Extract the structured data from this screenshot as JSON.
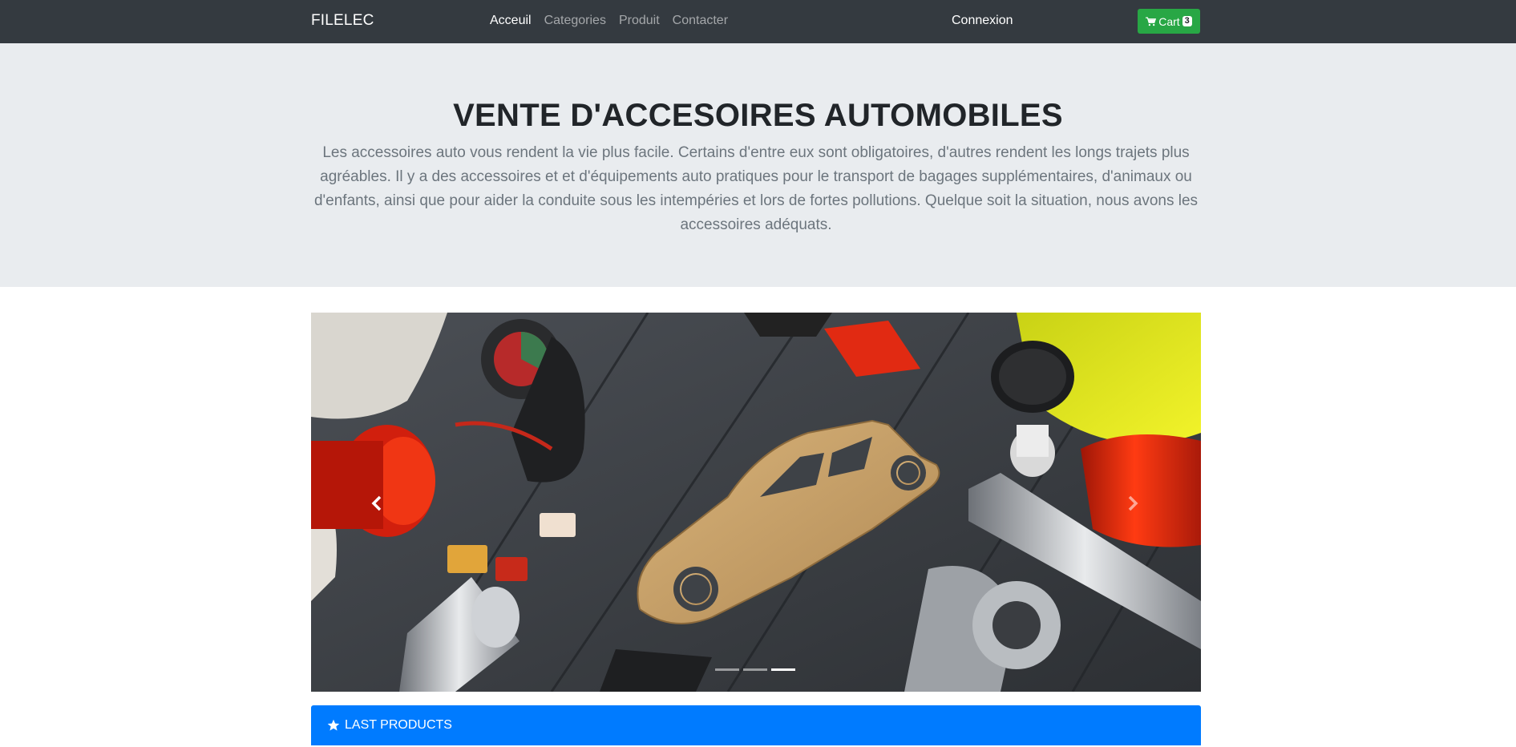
{
  "navbar": {
    "brand": "FILELEC",
    "links": [
      {
        "label": "Acceuil",
        "active": true
      },
      {
        "label": "Categories",
        "active": false
      },
      {
        "label": "Produit",
        "active": false
      },
      {
        "label": "Contacter",
        "active": false
      }
    ],
    "login_label": "Connexion",
    "cart": {
      "label": "Cart",
      "count": "3",
      "icon": "shopping-cart-icon",
      "color": "#28a745"
    },
    "background": "#343a40"
  },
  "jumbotron": {
    "title": "VENTE D'ACCESOIRES AUTOMOBILES",
    "text": "Les accessoires auto vous rendent la vie plus facile. Certains d'entre eux sont obligatoires, d'autres rendent les longs trajets plus agréables. Il y a des accessoires et et d'équipements auto pratiques pour le transport de bagages supplémentaires, d'animaux ou d'enfants, ainsi que pour aider la conduite sous les intempéries et lors de fortes pollutions. Quelque soit la situation, nous avons les accessoires adéquats."
  },
  "carousel": {
    "slide_count": 3,
    "active_slide": 3,
    "prev_icon": "chevron-left-icon",
    "next_icon": "chevron-right-icon"
  },
  "products_panel": {
    "title": "LAST PRODUCTS",
    "icon": "star-icon",
    "color": "#007bff"
  }
}
